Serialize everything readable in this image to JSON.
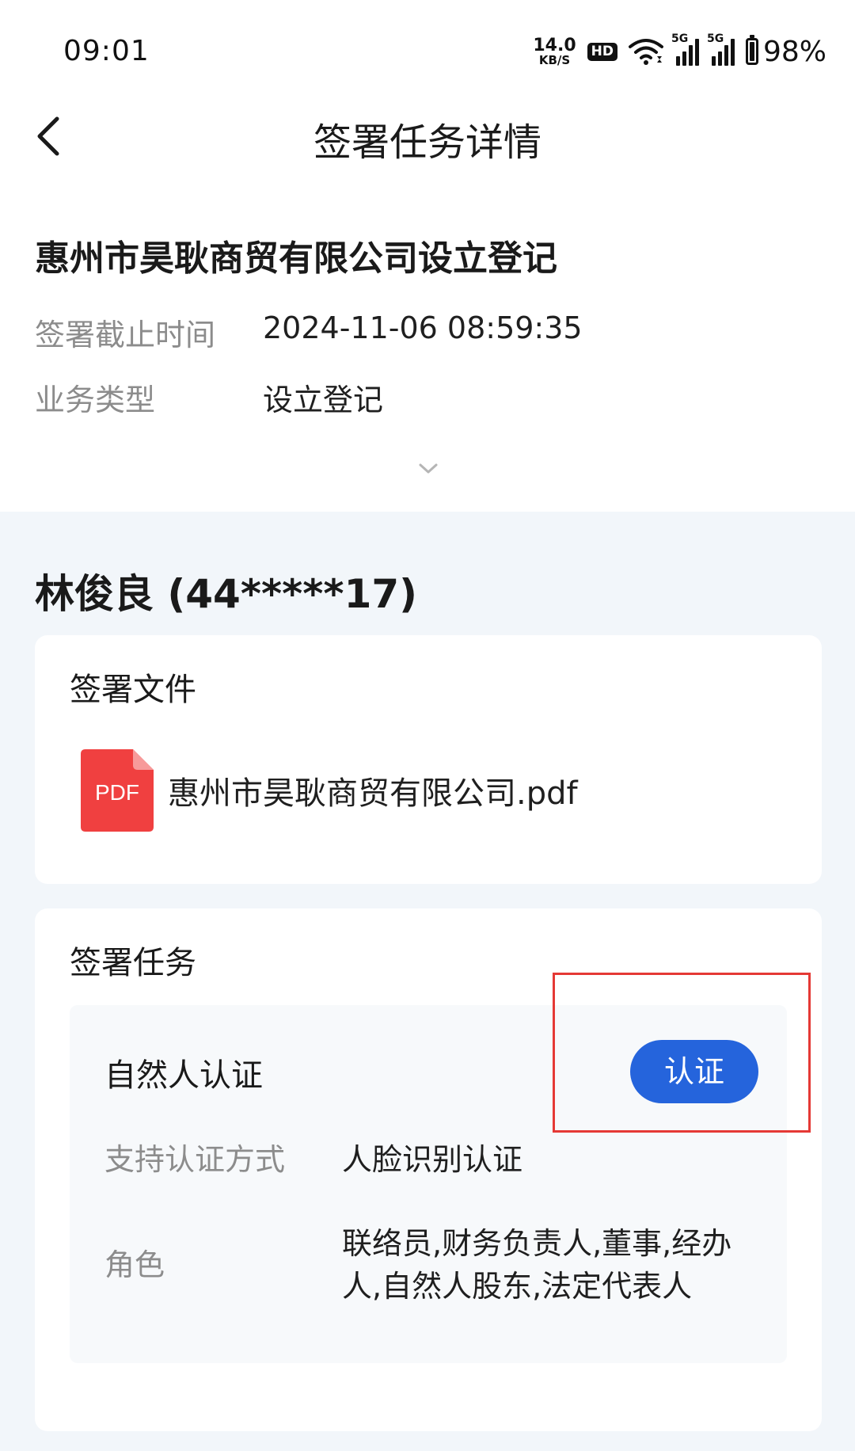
{
  "status_bar": {
    "time": "09:01",
    "net_speed_value": "14.0",
    "net_speed_unit": "KB/S",
    "hd_label": "HD",
    "signal1_label": "5G",
    "signal2_label": "5G",
    "battery_percent": "98%",
    "battery_level": 0.98
  },
  "nav": {
    "title": "签署任务详情",
    "back_icon": "chevron-left-icon"
  },
  "task": {
    "title": "惠州市昊耿商贸有限公司设立登记",
    "deadline_label": "签署截止时间",
    "deadline_value": "2024-11-06 08:59:35",
    "type_label": "业务类型",
    "type_value": "设立登记"
  },
  "signer": {
    "name": "林俊良 (44*****17)"
  },
  "files": {
    "title": "签署文件",
    "items": [
      {
        "icon_text": "PDF",
        "name": "惠州市昊耿商贸有限公司.pdf"
      }
    ]
  },
  "tasks": {
    "title": "签署任务",
    "items": [
      {
        "name": "自然人认证",
        "button_label": "认证",
        "method_label": "支持认证方式",
        "method_value": "人脸识别认证",
        "role_label": "角色",
        "role_value": "联络员,财务负责人,董事,经办人,自然人股东,法定代表人"
      }
    ]
  },
  "colors": {
    "primary": "#2564dc",
    "highlight": "#e53935",
    "pdf_red": "#f04040",
    "page_bg": "#f2f6fa"
  }
}
